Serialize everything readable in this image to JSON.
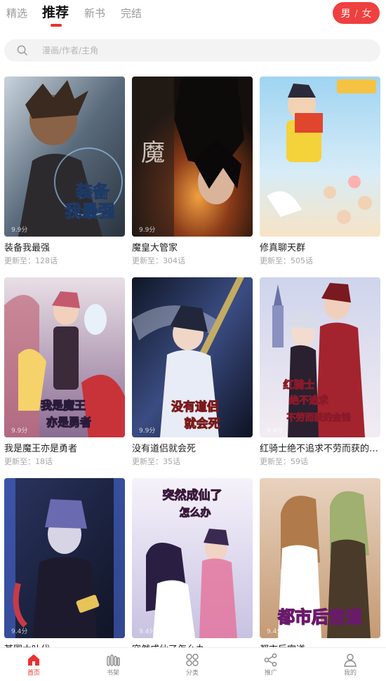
{
  "top_tabs": {
    "items": [
      {
        "label": "精选"
      },
      {
        "label": "推荐"
      },
      {
        "label": "新书"
      },
      {
        "label": "完结"
      }
    ],
    "active": "推荐"
  },
  "gender": {
    "male": "男",
    "separator": "/",
    "female": "女"
  },
  "search": {
    "placeholder": "漫画/作者/主角"
  },
  "comics": [
    {
      "title": "装备我最强",
      "update": "更新至：128话",
      "score": "9.9分",
      "cover_text": "装备\n我最强",
      "colors": [
        "#3a4a5c",
        "#8fa6b8",
        "#2a3440"
      ]
    },
    {
      "title": "魔皇大管家",
      "update": "更新至：304话",
      "score": "9.9分",
      "cover_text": "",
      "colors": [
        "#1a1512",
        "#6b3a1e",
        "#c0662a"
      ]
    },
    {
      "title": "修真聊天群",
      "update": "更新至：505话",
      "score": "",
      "cover_text": "",
      "colors": [
        "#bfe3f6",
        "#7fc3e8",
        "#f3d6a0"
      ]
    },
    {
      "title": "我是魔王亦是勇者",
      "update": "更新至：18话",
      "score": "9.9分",
      "cover_text": "我是魔王\n亦是勇者",
      "colors": [
        "#d9c3d6",
        "#9b6e9e",
        "#c8433f"
      ]
    },
    {
      "title": "没有道侣就会死",
      "update": "更新至：35话",
      "score": "9.9分",
      "cover_text": "没有道侣\n就会死",
      "colors": [
        "#1e2a48",
        "#4a5f9a",
        "#d6b25a"
      ]
    },
    {
      "title": "红骑士绝不追求不劳而获的…",
      "update": "更新至：59话",
      "score": "9.4分",
      "cover_text": "红骑士\n绝不追求\n不劳而获的金钱",
      "colors": [
        "#e6dcea",
        "#9a2830",
        "#6b7aa8"
      ]
    },
    {
      "title": "某国大叶代",
      "update": "",
      "score": "9.4分",
      "cover_text": "",
      "colors": [
        "#1c2236",
        "#4b5a9e",
        "#2f3a6a"
      ]
    },
    {
      "title": "突然成仙了怎么办",
      "update": "",
      "score": "9.4分",
      "cover_text": "突然成仙了\n怎么办",
      "colors": [
        "#e8e6f2",
        "#5a4aa0",
        "#e57a9a"
      ]
    },
    {
      "title": "都市后宫道",
      "update": "",
      "score": "9.4分",
      "cover_text": "都市后宫道",
      "colors": [
        "#e8d8c8",
        "#c9a070",
        "#8a2a6a"
      ]
    }
  ],
  "bottom_nav": {
    "items": [
      {
        "label": "首页",
        "icon": "home-icon",
        "active": true
      },
      {
        "label": "书架",
        "icon": "bookshelf-icon",
        "active": false
      },
      {
        "label": "分类",
        "icon": "category-icon",
        "active": false
      },
      {
        "label": "推广",
        "icon": "share-icon",
        "active": false
      },
      {
        "label": "我的",
        "icon": "profile-icon",
        "active": false
      }
    ],
    "active_color": "#e8322e"
  }
}
